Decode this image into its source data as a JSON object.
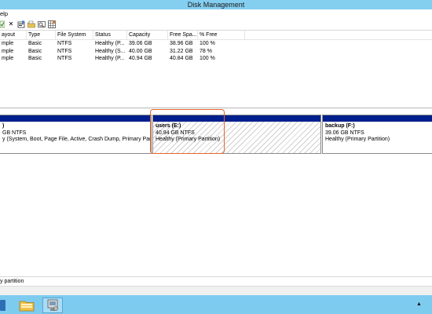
{
  "window": {
    "title": "Disk Management"
  },
  "menu": {
    "help_label": "elp"
  },
  "toolbar": {
    "icons": [
      "check-icon",
      "close-icon",
      "properties-icon",
      "open-folder-icon",
      "find-icon",
      "grid-icon"
    ],
    "close_glyph": "✕"
  },
  "volumes": {
    "columns": [
      "ayout",
      "Type",
      "File System",
      "Status",
      "Capacity",
      "Free Spa...",
      "% Free"
    ],
    "rows": [
      {
        "layout": "mple",
        "type": "Basic",
        "fs": "NTFS",
        "status": "Healthy (P...",
        "capacity": "39.06 GB",
        "free": "38.96 GB",
        "pct": "100 %"
      },
      {
        "layout": "mple",
        "type": "Basic",
        "fs": "NTFS",
        "status": "Healthy (S...",
        "capacity": "40.00 GB",
        "free": "31.22 GB",
        "pct": "78 %"
      },
      {
        "layout": "mple",
        "type": "Basic",
        "fs": "NTFS",
        "status": "Healthy (P...",
        "capacity": "40.94 GB",
        "free": "40.84 GB",
        "pct": "100 %"
      }
    ]
  },
  "partitions": {
    "system": {
      "name": ")",
      "size": "GB NTFS",
      "status": "y (System, Boot, Page File, Active, Crash Dump, Primary Partition)"
    },
    "users": {
      "name": "users  (E:)",
      "size": "40.94 GB NTFS",
      "status": "Healthy (Primary Partition)"
    },
    "backup": {
      "name": "backup  (F:)",
      "size": "39.06 GB NTFS",
      "status": "Healthy (Primary Partition)"
    }
  },
  "legend": {
    "label": "y partition"
  },
  "taskbar": {
    "tray_glyph": "▲"
  },
  "colors": {
    "titlebar": "#84cef0",
    "partition_bar": "#001f8e",
    "highlight": "#e8672a",
    "taskbar": "#7ecbf0"
  }
}
